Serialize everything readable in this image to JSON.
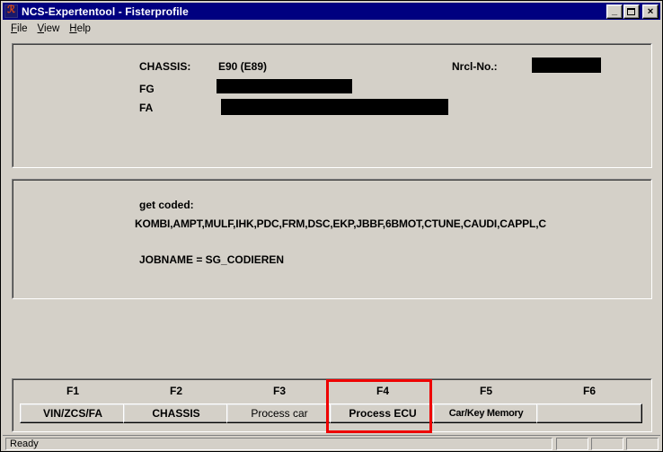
{
  "window": {
    "title": "NCS-Expertentool - Fisterprofile",
    "icon": "app-icon",
    "controls": {
      "minimize": "minimize-icon",
      "maximize": "maximize-icon",
      "close": "close-icon"
    }
  },
  "menubar": {
    "items": [
      {
        "label": "File",
        "accel": "F"
      },
      {
        "label": "View",
        "accel": "V"
      },
      {
        "label": "Help",
        "accel": "H"
      }
    ]
  },
  "vehicle_panel": {
    "chassis_label": "CHASSIS:",
    "chassis_value": "E90 (E89)",
    "fg_label": "FG",
    "fg_value": "",
    "fa_label": "FA",
    "fa_value": "",
    "nrcl_label": "Nrcl-No.:",
    "nrcl_value": ""
  },
  "job_panel": {
    "get_coded_label": "get coded:",
    "modules": "KOMBI,AMPT,MULF,IHK,PDC,FRM,DSC,EKP,JBBF,6BMOT,CTUNE,CAUDI,CAPPL,C",
    "jobname": "JOBNAME = SG_CODIEREN"
  },
  "function_keys": [
    {
      "key": "F1",
      "label": "VIN/ZCS/FA",
      "highlighted": false
    },
    {
      "key": "F2",
      "label": "CHASSIS",
      "highlighted": false
    },
    {
      "key": "F3",
      "label": "Process car",
      "highlighted": false
    },
    {
      "key": "F4",
      "label": "Process ECU",
      "highlighted": true
    },
    {
      "key": "F5",
      "label": "Car/Key Memory",
      "highlighted": false
    },
    {
      "key": "F6",
      "label": "",
      "highlighted": false
    }
  ],
  "annotation": {
    "highlight_color": "#ee0000",
    "target": "F4"
  },
  "statusbar": {
    "message": "Ready",
    "panes": [
      "",
      "",
      ""
    ]
  },
  "colors": {
    "titlebar": "#000080",
    "face": "#d4d0c8",
    "text": "#000000"
  }
}
